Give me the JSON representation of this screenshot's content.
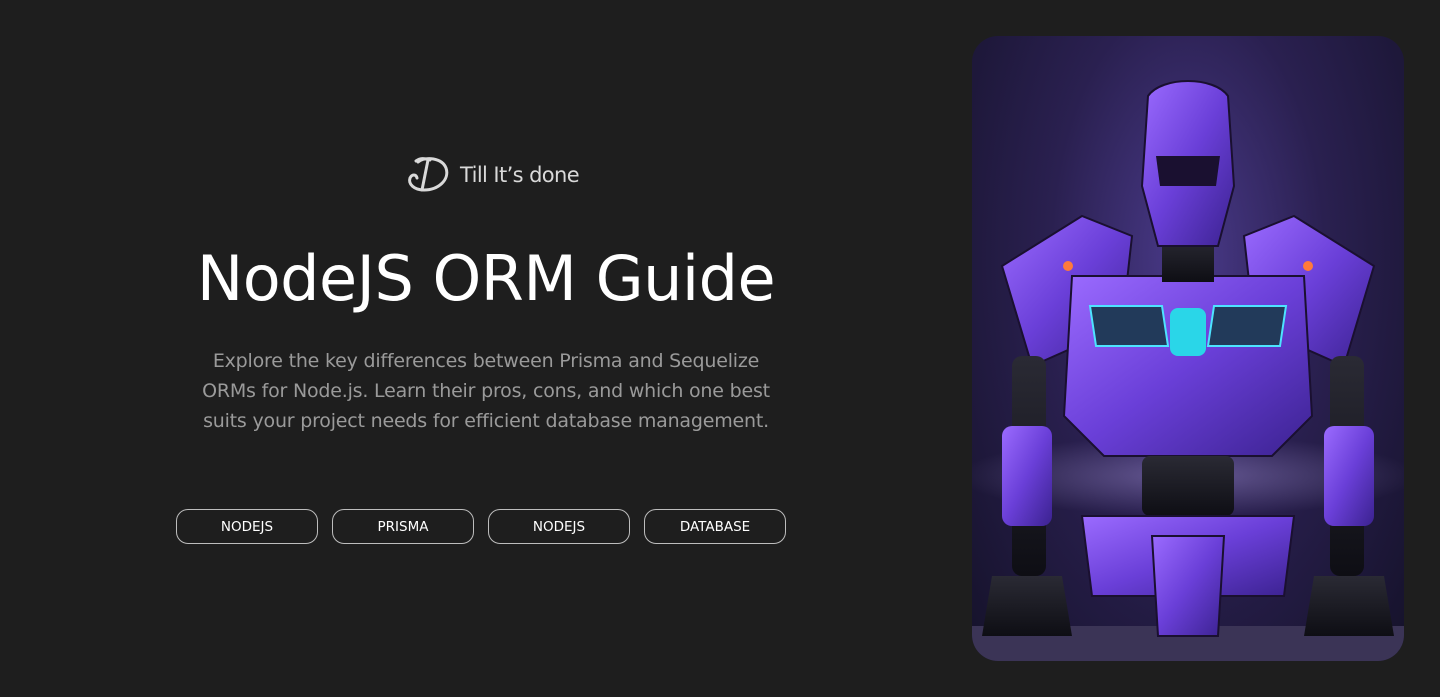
{
  "brand": {
    "name": "Till It’s done",
    "logo_icon": "signature-logo-icon"
  },
  "hero": {
    "title": "NodeJS ORM Guide",
    "description": "Explore the key differences between Prisma and Sequelize ORMs for Node.js. Learn their pros, cons, and which one best suits your project needs for efficient database management."
  },
  "tags": [
    {
      "label": "NODEJS"
    },
    {
      "label": "PRISMA"
    },
    {
      "label": "NODEJS"
    },
    {
      "label": "DATABASE"
    }
  ],
  "image": {
    "subject": "purple-robot-illustration"
  },
  "colors": {
    "background": "#1e1e1e",
    "text": "#ffffff",
    "muted_text": "#9a9a9a",
    "tag_border": "#bdbdbd",
    "accent": "#7b4fe0"
  }
}
